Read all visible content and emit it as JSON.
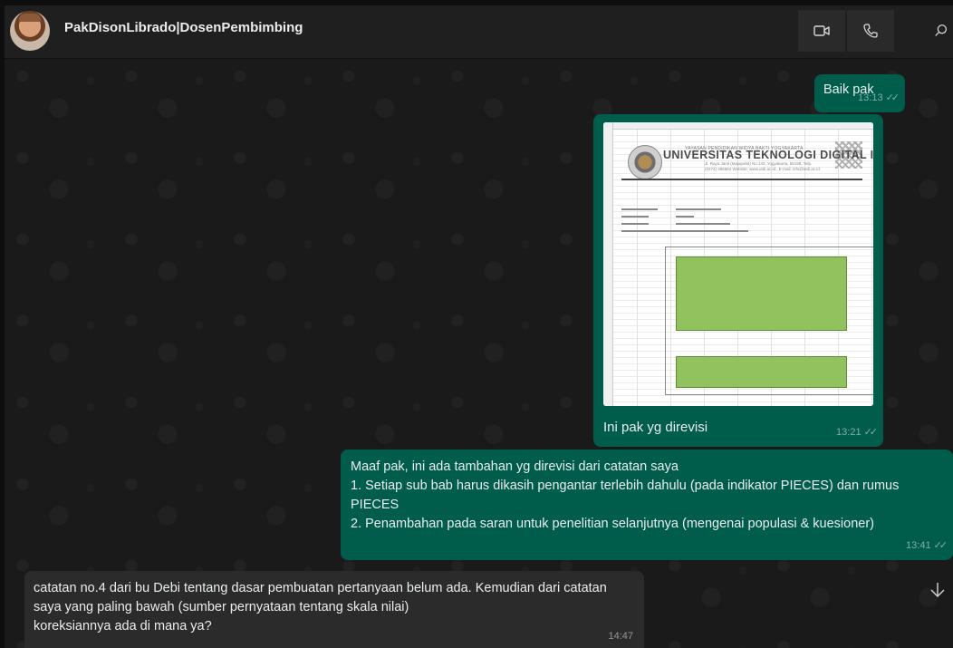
{
  "header": {
    "contact_name": "PakDisonLibrado|DosenPembimbing",
    "buttons": [
      "video-call",
      "voice-call",
      "search"
    ]
  },
  "messages": [
    {
      "direction": "out",
      "text": "Baik pak",
      "time": "13:13",
      "status": "read"
    },
    {
      "direction": "out",
      "type": "image",
      "caption": "Ini pak yg direvisi",
      "time": "13:21",
      "status": "read",
      "image": {
        "header_small": "YAYASAN PENDIDIKAN WIDYA BAKTI YOGYAKARTA",
        "title": "UNIVERSITAS TEKNOLOGI DIGITAL INDONESIA",
        "address": "Jl. Raya Janti (Majapahit) No.143, Yogyakarta, 55198, Telp. (0274) 486664 Website: www.utdi.ac.id , E-mail: info@utdi.ac.id"
      }
    },
    {
      "direction": "out",
      "text": "Maaf pak, ini ada tambahan yg direvisi dari catatan saya\n1. Setiap sub bab harus dikasih pengantar terlebih dahulu (pada indikator PIECES) dan rumus PIECES\n2. Penambahan pada saran untuk penelitian selanjutnya (mengenai populasi & kuesioner)",
      "time": "13:41",
      "status": "read"
    },
    {
      "direction": "in",
      "text": "catatan no.4 dari bu Debi tentang dasar pembuatan pertanyaan belum ada. Kemudian dari catatan saya yang paling bawah (sumber pernyataan tentang skala nilai)\nkoreksiannya ada di mana ya?",
      "time": "14:47"
    }
  ],
  "colors": {
    "outgoing_bubble": "#005c4b",
    "incoming_bubble": "#2b2b2b",
    "header_bg": "#1f1f1f"
  }
}
